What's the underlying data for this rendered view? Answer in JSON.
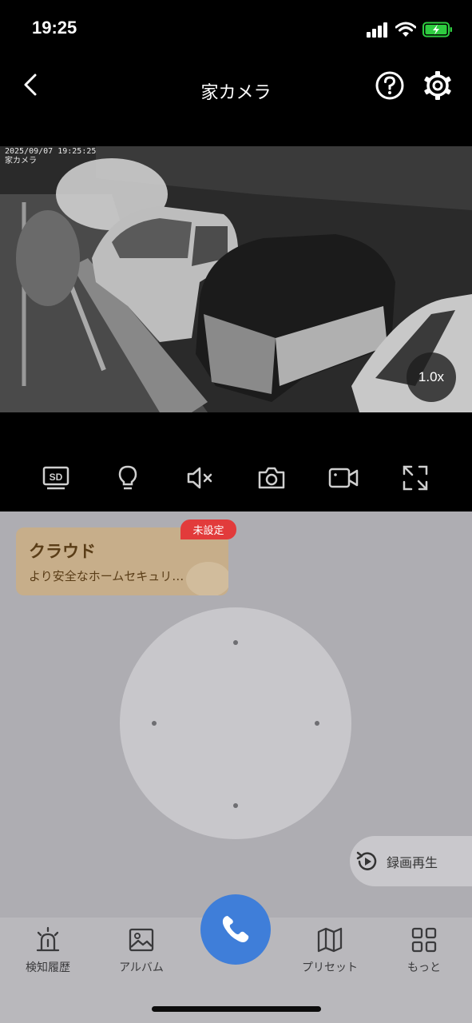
{
  "status_bar": {
    "time": "19:25"
  },
  "header": {
    "title": "家カメラ"
  },
  "video": {
    "osd_timestamp": "2025/09/07 19:25:25",
    "osd_camera_name": "家カメラ",
    "zoom": "1.0x"
  },
  "controls": [
    {
      "name": "sd-icon",
      "label": "SD"
    },
    {
      "name": "lightbulb-icon"
    },
    {
      "name": "mute-icon"
    },
    {
      "name": "camera-icon"
    },
    {
      "name": "video-record-icon"
    },
    {
      "name": "fullscreen-icon"
    }
  ],
  "cloud": {
    "title": "クラウド",
    "description": "より安全なホームセキュリ…",
    "badge": "未設定"
  },
  "playback": {
    "label": "録画再生"
  },
  "bottom_nav": {
    "items": [
      {
        "label": "検知履歴",
        "icon": "alarm-icon"
      },
      {
        "label": "アルバム",
        "icon": "album-icon"
      },
      {
        "label": "プリセット",
        "icon": "map-icon"
      },
      {
        "label": "もっと",
        "icon": "grid-icon"
      }
    ],
    "call_icon": "phone-icon"
  },
  "colors": {
    "call": "#3f7ed9",
    "badge": "#e23b3b",
    "cloud_card": "#c7ae8a",
    "panel": "#aeadb2"
  }
}
